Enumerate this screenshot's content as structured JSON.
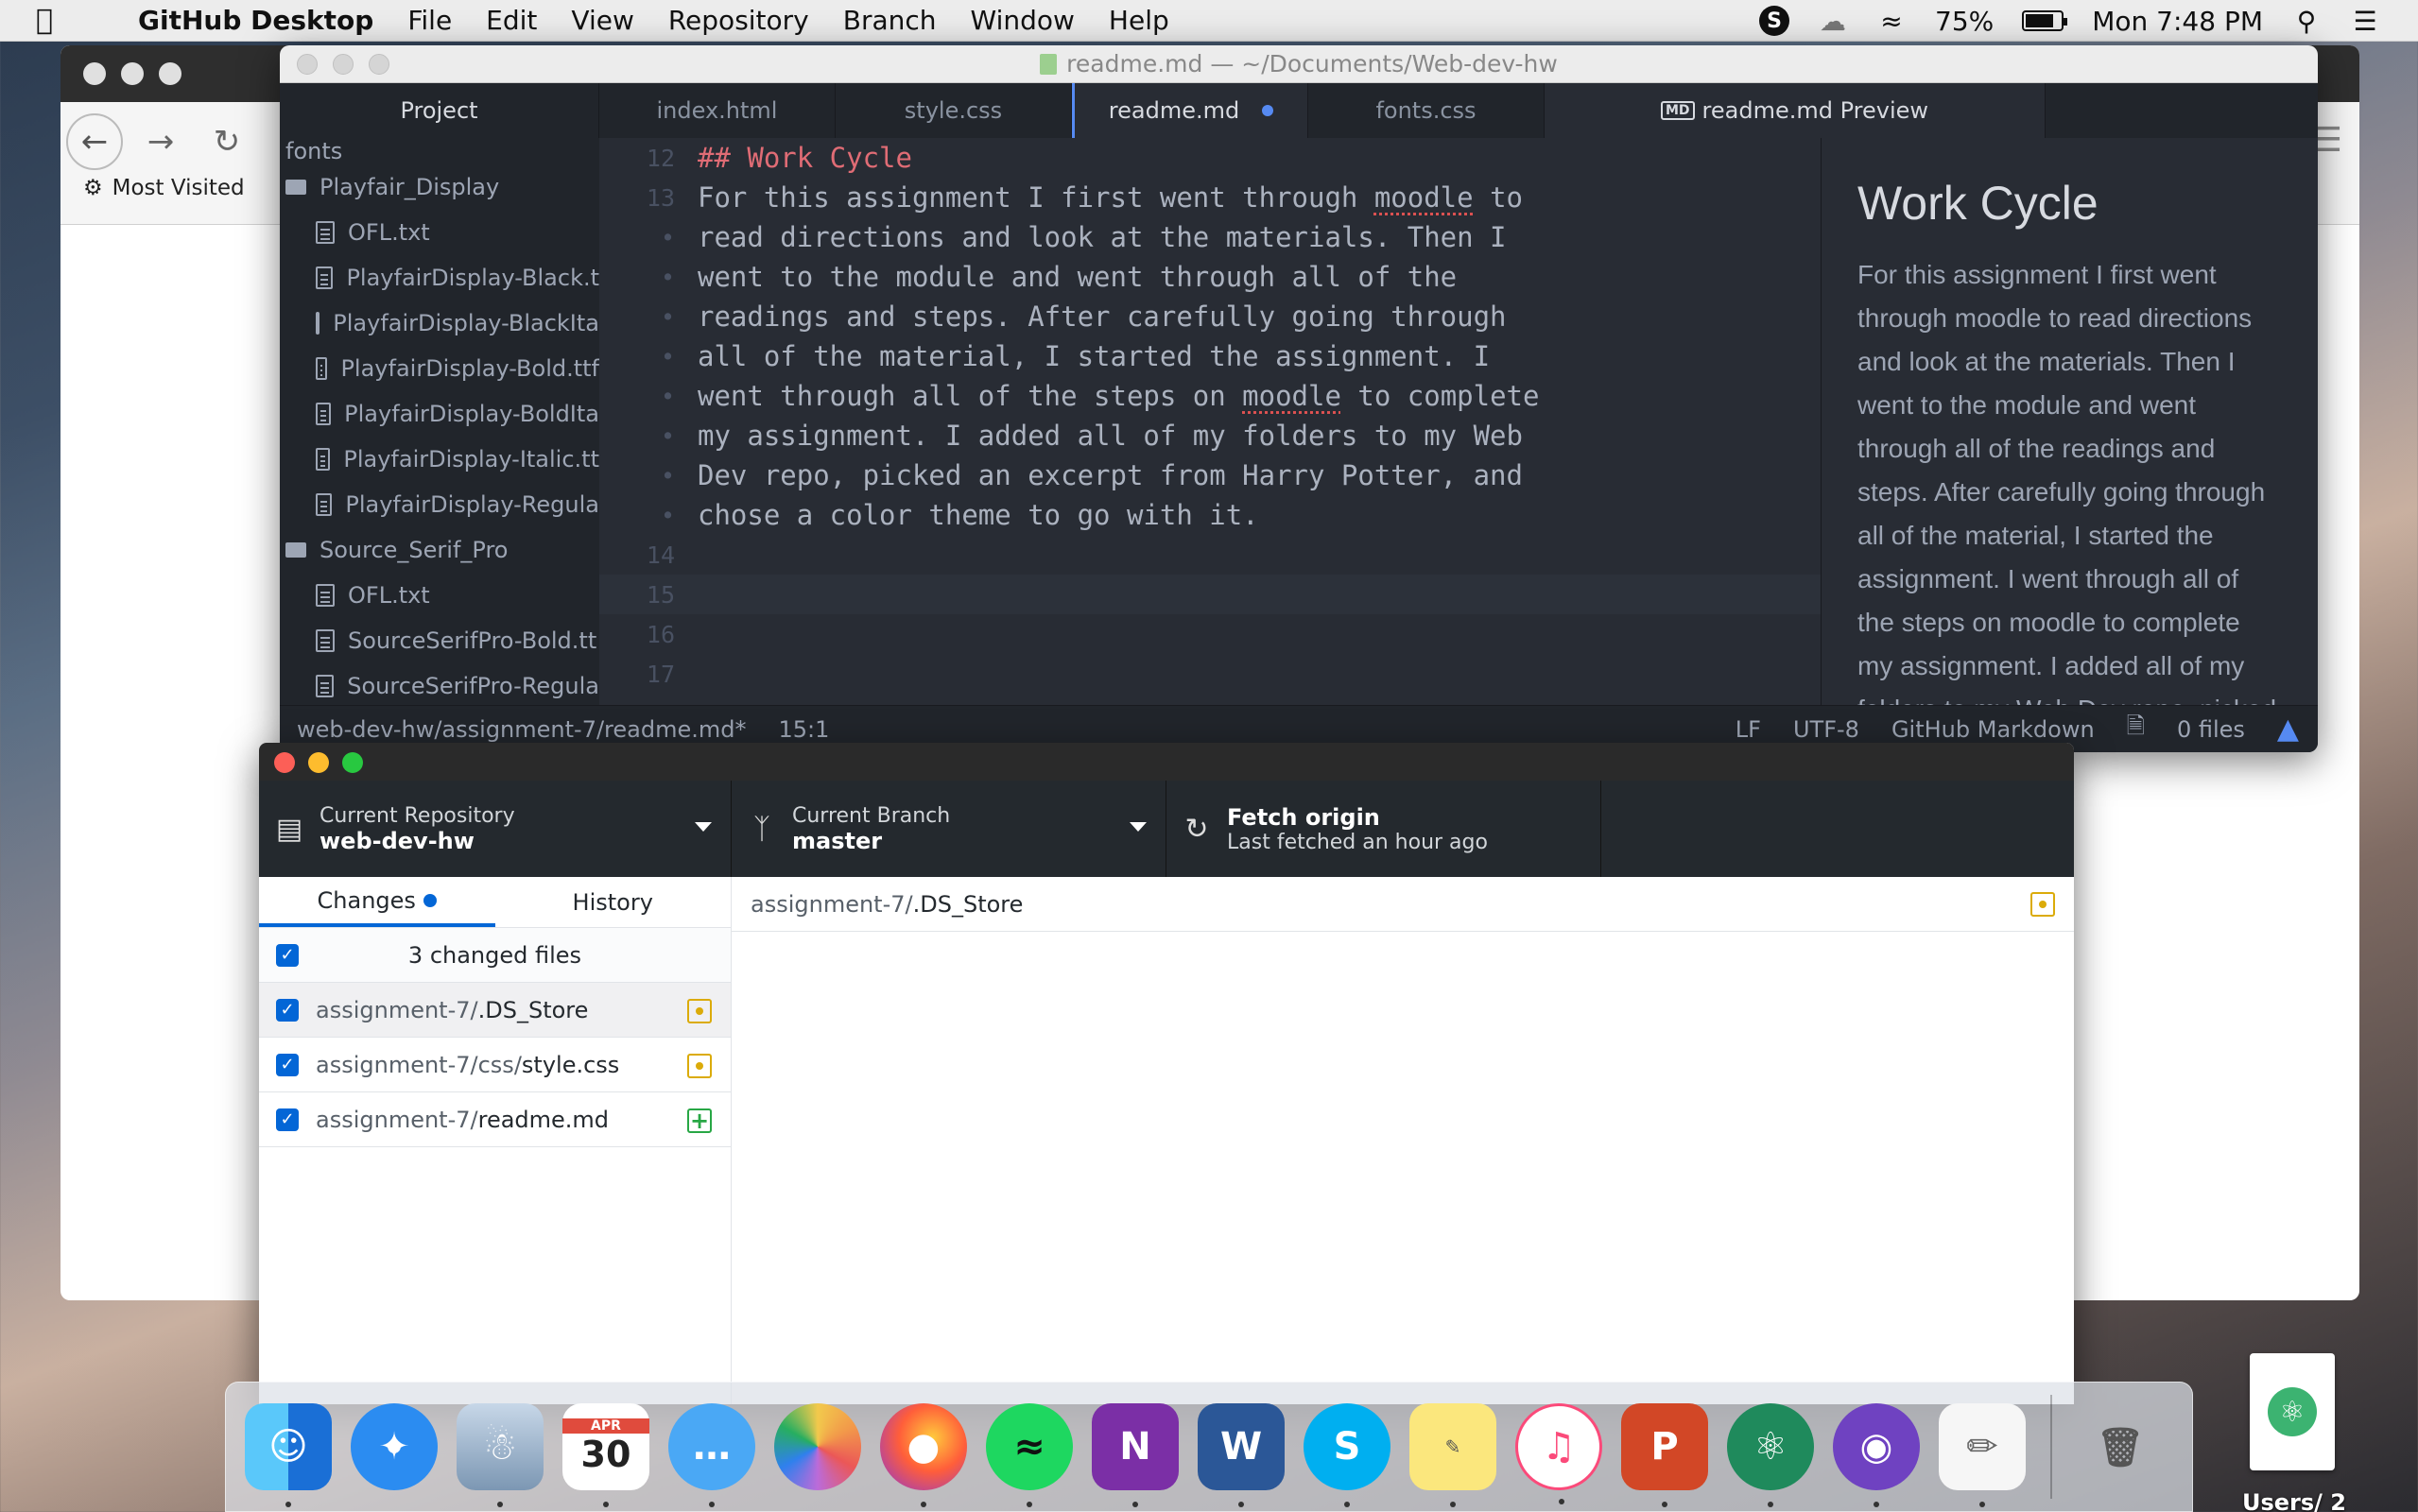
{
  "menubar": {
    "app_name": "GitHub Desktop",
    "items": [
      "File",
      "Edit",
      "View",
      "Repository",
      "Branch",
      "Window",
      "Help"
    ],
    "battery": "75%",
    "clock": "Mon 7:48 PM"
  },
  "browser": {
    "bookmark": "Most Visited"
  },
  "atom": {
    "window_title": "readme.md — ~/Documents/Web-dev-hw",
    "tabs": {
      "project": "Project",
      "t1": "index.html",
      "t2": "style.css",
      "active": "readme.md",
      "t4": "fonts.css",
      "preview": "readme.md Preview",
      "preview_icon_text": "MD"
    },
    "tree": {
      "top_cut": "fonts",
      "folder1": "Playfair_Display",
      "folder1_files": [
        "OFL.txt",
        "PlayfairDisplay-Black.t",
        "PlayfairDisplay-BlackIta",
        "PlayfairDisplay-Bold.ttf",
        "PlayfairDisplay-BoldIta",
        "PlayfairDisplay-Italic.tt",
        "PlayfairDisplay-Regula"
      ],
      "folder2": "Source_Serif_Pro",
      "folder2_files": [
        "OFL.txt",
        "SourceSerifPro-Bold.tt",
        "SourceSerifPro-Regula"
      ]
    },
    "editor": {
      "lines": [
        {
          "num": "12",
          "text": "## Work Cycle"
        },
        {
          "num": "13",
          "text": "For this assignment I first went through moodle to"
        },
        {
          "num": "•",
          "text": "read directions and look at the materials. Then I"
        },
        {
          "num": "•",
          "text": "went to the module and went through all of the"
        },
        {
          "num": "•",
          "text": "readings and steps. After carefully going through"
        },
        {
          "num": "•",
          "text": "all of the material, I started the assignment. I"
        },
        {
          "num": "•",
          "text": "went through all of the steps on moodle to complete"
        },
        {
          "num": "•",
          "text": "my assignment. I added all of my folders to my Web"
        },
        {
          "num": "•",
          "text": "Dev repo, picked an excerpt from Harry Potter, and"
        },
        {
          "num": "•",
          "text": "chose a color theme to go with it."
        },
        {
          "num": "14",
          "text": ""
        },
        {
          "num": "15",
          "text": ""
        },
        {
          "num": "16",
          "text": ""
        },
        {
          "num": "17",
          "text": ""
        }
      ]
    },
    "preview": {
      "heading": "Work Cycle",
      "body": "For this assignment I first went through moodle to read directions and look at the materials. Then I went to the module and went through all of the readings and steps. After carefully going through all of the material, I started the assignment. I went through all of the steps on moodle to complete my assignment. I added all of my folders to my Web Dev repo, picked an excerpt from Harry Potter, and chose a color theme to go with it."
    },
    "status": {
      "path": "web-dev-hw/assignment-7/readme.md*",
      "cursor": "15:1",
      "line_ending": "LF",
      "encoding": "UTF-8",
      "grammar": "GitHub Markdown",
      "files": "0 files"
    }
  },
  "ghd": {
    "repo_label": "Current Repository",
    "repo_value": "web-dev-hw",
    "branch_label": "Current Branch",
    "branch_value": "master",
    "fetch_label": "Fetch origin",
    "fetch_sub": "Last fetched an hour ago",
    "tab_changes": "Changes",
    "tab_history": "History",
    "changed_count": "3 changed files",
    "files": [
      {
        "path": "assignment-7/",
        "name": ".DS_Store",
        "status": "modified"
      },
      {
        "path": "assignment-7/css/",
        "name": "style.css",
        "status": "modified"
      },
      {
        "path": "assignment-7/",
        "name": "readme.md",
        "status": "added"
      }
    ],
    "diff_path": "assignment-7/",
    "diff_name": ".DS_Store"
  },
  "dock": {
    "apps": [
      "finder",
      "safari",
      "preview",
      "calendar",
      "messages",
      "photos",
      "firefox",
      "spotify",
      "onenote",
      "word",
      "skype",
      "stickies",
      "itunes",
      "powerpoint",
      "atom",
      "github-desktop",
      "textedit",
      "trash"
    ],
    "calendar_month": "APR",
    "calendar_day": "30"
  },
  "desktop": {
    "file_label": "Users/ 2"
  },
  "colors": {
    "atom_bg": "#282c34",
    "accent_blue": "#568af2",
    "gh_blue": "#0366d6",
    "heading_red": "#e06c75",
    "modified_yellow": "#dbab09",
    "added_green": "#28a745"
  }
}
